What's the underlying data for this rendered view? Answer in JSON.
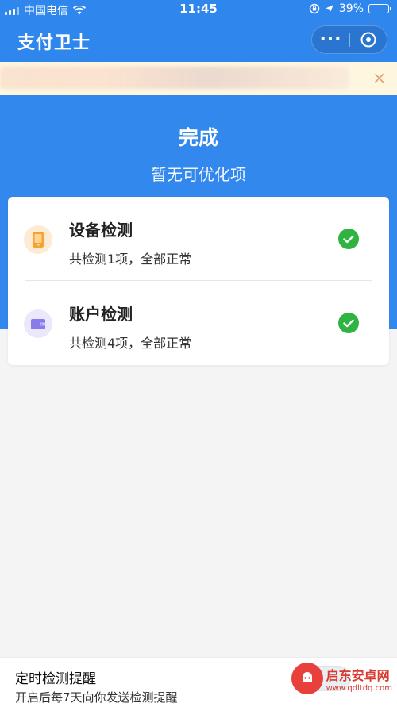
{
  "status_bar": {
    "carrier": "中国电信",
    "time": "11:45",
    "battery": "39%",
    "battery_level": 0.39,
    "wifi_icon": "wifi-icon",
    "location_icon": "location-arrow-icon",
    "lock_icon": "rotation-lock-icon"
  },
  "nav": {
    "title": "支付卫士",
    "more_label": "···"
  },
  "banner": {
    "close_label": "×"
  },
  "header": {
    "headline": "完成",
    "subline": "暂无可优化项",
    "color": "#3388ee"
  },
  "checks": [
    {
      "title": "设备检测",
      "desc": "共检测1项，全部正常",
      "icon": "phone-icon",
      "icon_bg": "#fdebd3",
      "icon_color": "#f6a233"
    },
    {
      "title": "账户检测",
      "desc": "共检测4项，全部正常",
      "icon": "wallet-icon",
      "icon_bg": "#ebe8fb",
      "icon_color": "#8a7bea"
    }
  ],
  "check_color": "#2fb441",
  "reminder": {
    "title": "定时检测提醒",
    "desc": "开启后每7天向你发送检测提醒",
    "enabled": false
  },
  "watermark": {
    "name": "启东安卓网",
    "url": "www.qdltdq.com"
  }
}
